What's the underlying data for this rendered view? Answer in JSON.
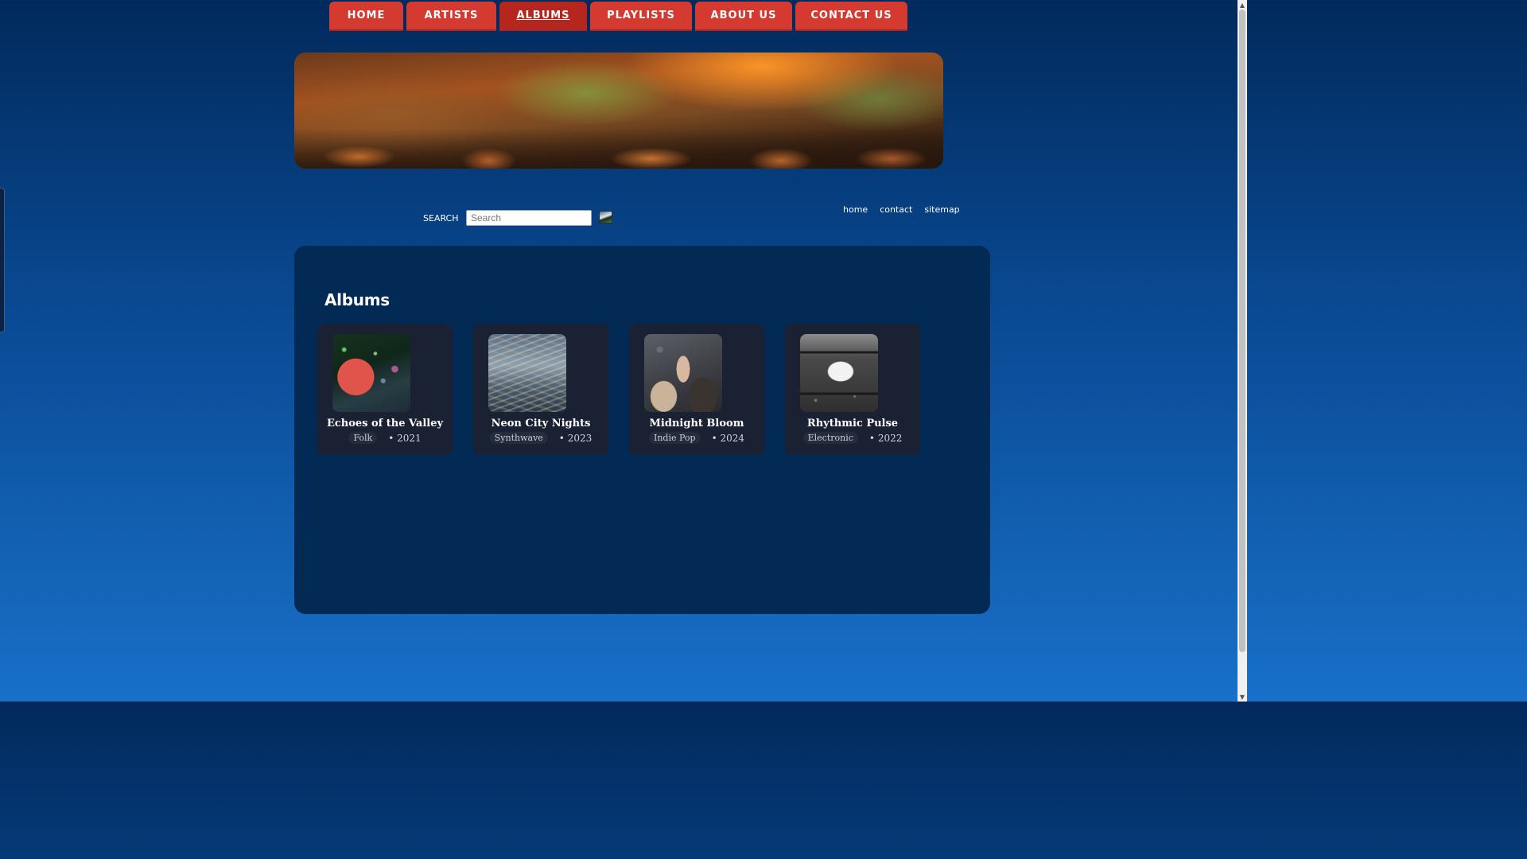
{
  "nav": {
    "items": [
      {
        "label": "HOME"
      },
      {
        "label": "ARTISTS"
      },
      {
        "label": "ALBUMS"
      },
      {
        "label": "PLAYLISTS"
      },
      {
        "label": "ABOUT US"
      },
      {
        "label": "CONTACT US"
      }
    ],
    "active": "ALBUMS",
    "color": "#d43a30"
  },
  "search": {
    "label": "SEARCH",
    "placeholder": "Search",
    "value": ""
  },
  "util_links": [
    "home",
    "contact",
    "sitemap"
  ],
  "main": {
    "title": "Albums",
    "albums": [
      {
        "title": "Echoes of the Valley",
        "genre": "Folk",
        "year": "• 2021",
        "cover_icon": "red-umbrella-image"
      },
      {
        "title": "Neon City Nights",
        "genre": "Synthwave",
        "year": "• 2023",
        "cover_icon": "blurred-water-image"
      },
      {
        "title": "Midnight Bloom",
        "genre": "Indie Pop",
        "year": "• 2024",
        "cover_icon": "hand-on-glass-image"
      },
      {
        "title": "Rhythmic Pulse",
        "genre": "Electronic",
        "year": "• 2022",
        "cover_icon": "train-window-image"
      }
    ]
  },
  "colors": {
    "background_top": "#012a5c",
    "background_bottom": "#1870c8",
    "panel": "#022a55",
    "card": "#192133"
  }
}
